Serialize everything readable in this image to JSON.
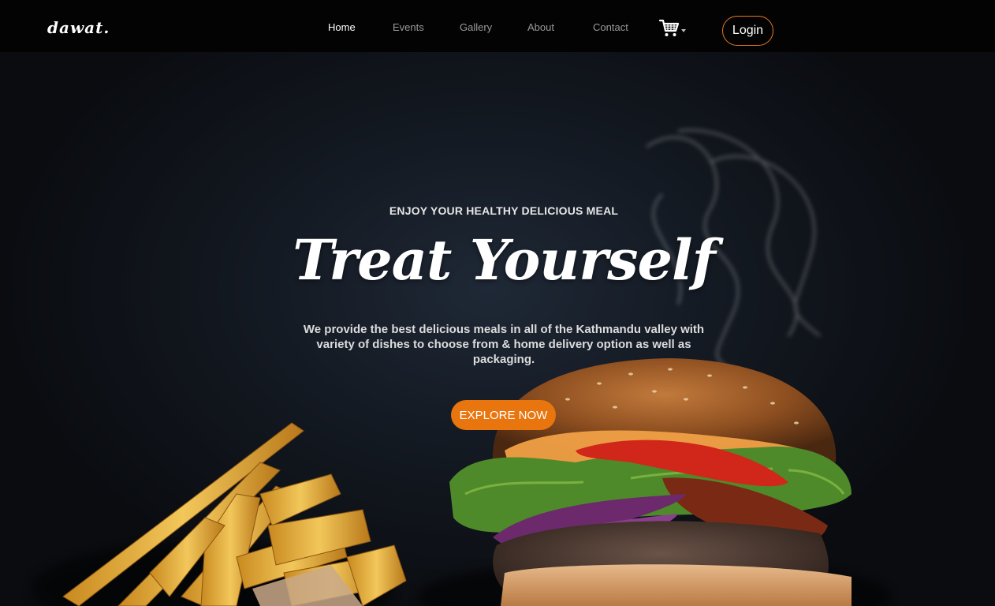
{
  "brand": {
    "name": "dawat."
  },
  "nav": {
    "items": [
      {
        "label": "Home",
        "active": true
      },
      {
        "label": "Events",
        "active": false
      },
      {
        "label": "Gallery",
        "active": false
      },
      {
        "label": "About",
        "active": false
      },
      {
        "label": "Contact",
        "active": false
      }
    ],
    "cart_icon": "shopping-cart-icon",
    "login_label": "Login"
  },
  "hero": {
    "eyebrow": "ENJOY YOUR HEALTHY DELICIOUS MEAL",
    "headline": "Treat Yourself",
    "description": "We provide the best delicious meals in all of the Kathmandu valley with variety of dishes to choose from & home delivery option as well as packaging.",
    "cta_label": "EXPLORE NOW"
  },
  "colors": {
    "accent": "#e8750e",
    "navbar_bg": "#030303",
    "hero_bg": "#141a23"
  }
}
